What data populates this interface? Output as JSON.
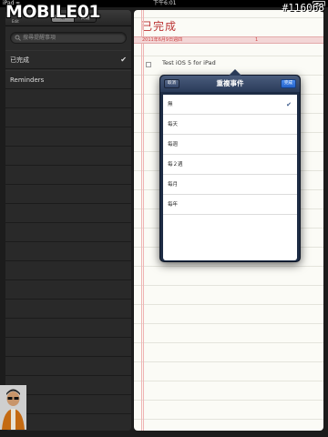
{
  "status_bar": {
    "carrier": "iPad",
    "time": "下午6:01"
  },
  "watermark": {
    "logo_text": "MOBILE01",
    "id": "#116068"
  },
  "sidebar": {
    "edit_label": "Edit",
    "segments": [
      "清",
      "日期"
    ],
    "search_placeholder": "搜尋提醒事項",
    "items": [
      {
        "label": "已完成",
        "checked": true
      },
      {
        "label": "Reminders",
        "checked": false
      }
    ]
  },
  "main": {
    "title": "已完成",
    "date_header": "2011年6月9日週四",
    "date_count": "1",
    "task": {
      "text": "Test iOS 5 for iPad"
    }
  },
  "popover": {
    "title": "重複事件",
    "cancel_label": "取消",
    "done_label": "完成",
    "options": [
      {
        "label": "無",
        "selected": true
      },
      {
        "label": "每天",
        "selected": false
      },
      {
        "label": "每週",
        "selected": false
      },
      {
        "label": "每２週",
        "selected": false
      },
      {
        "label": "每月",
        "selected": false
      },
      {
        "label": "每年",
        "selected": false
      }
    ]
  },
  "icons": {
    "search": "magnifier-icon",
    "check": "checkmark-icon",
    "wifi": "wifi-icon",
    "battery": "battery-icon"
  },
  "colors": {
    "accent_red": "#b33333",
    "popover_blue": "#1d2c45",
    "done_blue": "#2563cc"
  }
}
